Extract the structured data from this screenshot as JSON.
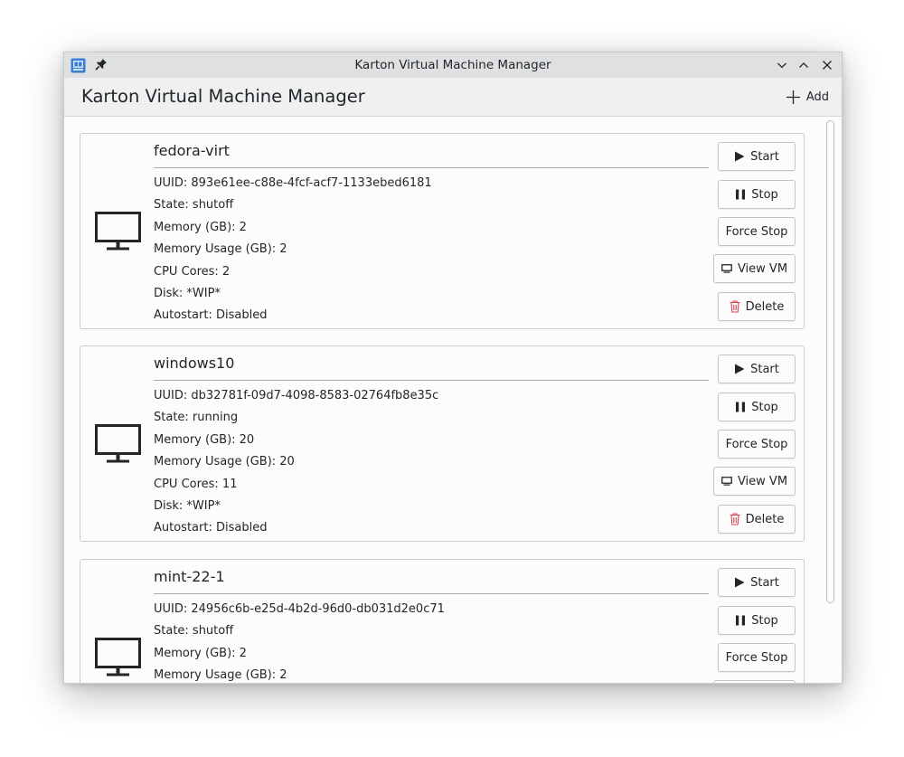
{
  "window": {
    "title": "Karton Virtual Machine Manager"
  },
  "header": {
    "title": "Karton Virtual Machine Manager",
    "add_label": "Add"
  },
  "buttons": {
    "start": "Start",
    "stop": "Stop",
    "force_stop": "Force Stop",
    "view_vm": "View VM",
    "delete": "Delete"
  },
  "vms": [
    {
      "name": "fedora-virt",
      "uuid": "UUID: 893e61ee-c88e-4fcf-acf7-1133ebed6181",
      "state": "State: shutoff",
      "memory": "Memory (GB): 2",
      "memory_usage": "Memory Usage (GB): 2",
      "cpu": "CPU Cores: 2",
      "disk": "Disk: *WIP*",
      "autostart": "Autostart: Disabled"
    },
    {
      "name": "windows10",
      "uuid": "UUID: db32781f-09d7-4098-8583-02764fb8e35c",
      "state": "State: running",
      "memory": "Memory (GB): 20",
      "memory_usage": "Memory Usage (GB): 20",
      "cpu": "CPU Cores: 11",
      "disk": "Disk: *WIP*",
      "autostart": "Autostart: Disabled"
    },
    {
      "name": "mint-22-1",
      "uuid": "UUID: 24956c6b-e25d-4b2d-96d0-db031d2e0c71",
      "state": "State: shutoff",
      "memory": "Memory (GB): 2",
      "memory_usage": "Memory Usage (GB): 2"
    }
  ],
  "colors": {
    "titlebar": "#dee0e2",
    "header": "#eff0f1",
    "delete_icon": "#da4453",
    "text": "#232629"
  },
  "icons": {
    "app": "karton-app-icon",
    "pin": "pin-icon",
    "minimize": "minimize-icon",
    "maximize": "maximize-icon",
    "close": "close-icon",
    "add": "plus-icon",
    "monitor": "monitor-icon",
    "start": "play-icon",
    "stop": "pause-icon",
    "view": "screen-icon",
    "delete": "trash-icon"
  }
}
